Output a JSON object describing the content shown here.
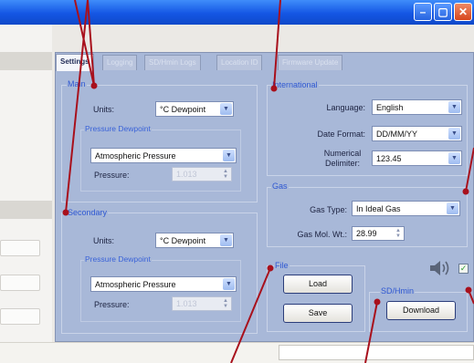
{
  "tabs": [
    {
      "label": "Settings",
      "active": true
    },
    {
      "label": "Logging",
      "active": false
    },
    {
      "label": "SD/Hmin Logs",
      "active": false
    },
    {
      "label": "Location ID",
      "active": false
    },
    {
      "label": "Firmware Update",
      "active": false
    }
  ],
  "main_group": {
    "legend": "Main",
    "units_label": "Units:",
    "units_value": "°C Dewpoint",
    "pressure_dewpoint_legend": "Pressure Dewpoint",
    "pressure_mode_value": "Atmospheric Pressure",
    "pressure_label": "Pressure:",
    "pressure_value": "1.013"
  },
  "secondary_group": {
    "legend": "Secondary",
    "units_label": "Units:",
    "units_value": "°C Dewpoint",
    "pressure_dewpoint_legend": "Pressure Dewpoint",
    "pressure_mode_value": "Atmospheric Pressure",
    "pressure_label": "Pressure:",
    "pressure_value": "1.013"
  },
  "international_group": {
    "legend": "International",
    "language_label": "Language:",
    "language_value": "English",
    "date_format_label": "Date Format:",
    "date_format_value": "DD/MM/YY",
    "delimiter_label_line1": "Numerical",
    "delimiter_label_line2": "Delimiter:",
    "delimiter_value": "123.45"
  },
  "gas_group": {
    "legend": "Gas",
    "gas_type_label": "Gas Type:",
    "gas_type_value": "In Ideal Gas",
    "gas_mol_label": "Gas Mol. Wt.:",
    "gas_mol_value": "28.99"
  },
  "file_group": {
    "legend": "File",
    "load_label": "Load",
    "save_label": "Save"
  },
  "sdhmin_group": {
    "legend": "SD/Hmin",
    "download_label": "Download"
  },
  "sound_checked": true,
  "colors": {
    "panel": "#a8b8d8",
    "legend_text": "#2f58d2",
    "callout": "#a8101c",
    "titlebar": "#1456e4"
  },
  "icons": {
    "minimize": "minimize-icon",
    "maximize": "maximize-icon",
    "close": "close-icon",
    "dropdown": "chevron-down-icon",
    "spinner": "spinner-arrows-icon",
    "speaker": "speaker-icon",
    "checkbox": "checkbox-icon"
  }
}
